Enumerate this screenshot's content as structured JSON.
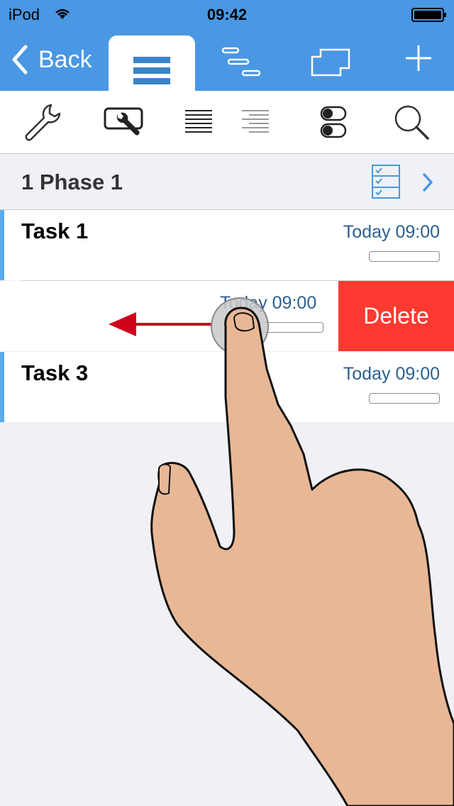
{
  "status": {
    "carrier": "iPod",
    "time": "09:42"
  },
  "nav": {
    "back_label": "Back",
    "icons": [
      "list-view-icon",
      "gantt-icon",
      "layers-icon",
      "add-icon"
    ]
  },
  "toolbar": {
    "icons": [
      "wrench-icon",
      "task-tools-icon",
      "text-align-icon",
      "text-align-light-icon",
      "toggle-icon",
      "search-icon"
    ]
  },
  "phase": {
    "title": "1 Phase 1"
  },
  "tasks": [
    {
      "name": "Task 1",
      "date": "Today 09:00"
    },
    {
      "name": "",
      "date": "Today 09:00"
    },
    {
      "name": "Task 3",
      "date": "Today 09:00"
    }
  ],
  "delete_label": "Delete",
  "colors": {
    "accent": "#4a97e3",
    "delete": "#fc3a31",
    "date": "#2b5f92",
    "arrow": "#d0021b",
    "skin": "#e8b896"
  }
}
